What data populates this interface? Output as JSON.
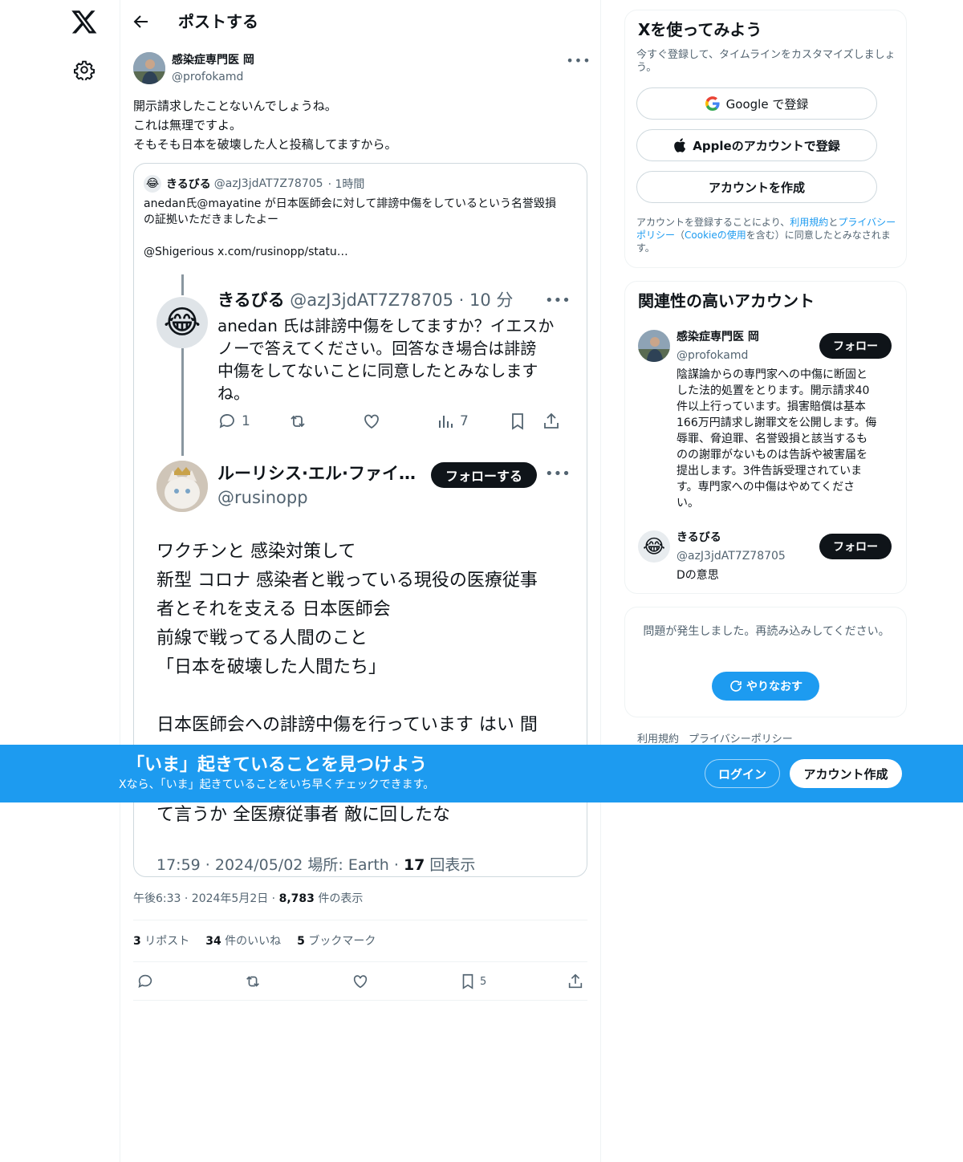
{
  "header": {
    "title": "ポストする"
  },
  "post": {
    "author_name": "感染症専門医 岡",
    "author_handle": "@profokamd",
    "text_lines": [
      "開示請求したことないんでしょうね。",
      "これは無理ですよ。",
      "そもそも日本を破壊した人と投稿してますから。"
    ],
    "quote": {
      "avatar_emoji": "😂",
      "name": "きるびる",
      "handle": "@azJ3jdAT7Z78705",
      "time": "· 1時間",
      "text_lines": [
        "anedan氏@mayatine が日本医師会に対して誹謗中傷をしているという名誉毀損",
        "の証拠いただきましたよー"
      ],
      "link": "@Shigerious  x.com/rusinopp/statu…",
      "screenshot": {
        "reply_name": "きるびる",
        "reply_meta": " @azJ3jdAT7Z78705 · 10 分",
        "reply_lines": [
          "anedan 氏は誹謗中傷をしてますか？イエスか",
          "ノーで答えてください。回答なき場合は誹謗",
          "中傷をしてないことに同意したとみなします",
          "ね。"
        ],
        "reply_reply_count": "1",
        "reply_view_count": "7",
        "orig_name": "ルーリシス·エル·ファイ…",
        "orig_handle": "@rusinopp",
        "follow_label": "フォローする",
        "body_lines": [
          "ワクチンと 感染対策して",
          "新型 コロナ 感染者と戦っている現役の医療従事",
          "者とそれを支える 日本医師会",
          "前線で戦ってる人間のこと",
          "「日本を破壊した人間たち」",
          "",
          "日本医師会への誹謗中傷を行っています はい 間"
        ],
        "tail_line": "て言うか 全医療従事者 敵に回したな",
        "meta_prefix": "17:59 · 2024/05/02 場所: Earth · ",
        "meta_views": "17",
        "meta_suffix": " 回表示"
      }
    },
    "timestamp": "午後6:33 · 2024年5月2日 · ",
    "views": "8,783",
    "views_label": " 件の表示",
    "reposts": "3",
    "reposts_label": " リポスト",
    "likes": "34",
    "likes_label": " 件のいいね",
    "bookmarks": "5",
    "bookmarks_label": " ブックマーク",
    "bookmark_count": "5"
  },
  "signup_card": {
    "title": "Xを使ってみよう",
    "subtitle": "今すぐ登録して、タイムラインをカスタマイズしましょう。",
    "google_label": "Google で登録",
    "apple_label": "Appleのアカウントで登録",
    "create_label": "アカウントを作成",
    "legal_1": "アカウントを登録することにより、",
    "legal_terms": "利用規約",
    "legal_2": "と",
    "legal_privacy": "プライバシーポリシー",
    "legal_3": "（",
    "legal_cookie": "Cookieの使用",
    "legal_4": "を含む）に同意したとみなされます。"
  },
  "related": {
    "title": "関連性の高いアカウント",
    "accounts": [
      {
        "name": "感染症専門医 岡",
        "handle": "@profokamd",
        "follow": "フォロー",
        "bio_lines": [
          "陰謀論からの専門家への中傷に断固と",
          "した法的処置をとります。開示請求40",
          "件以上行っています。損害賠償は基本",
          "166万円請求し謝罪文を公開します。侮",
          "辱罪、脅迫罪、名誉毀損と該当するも",
          "のの謝罪がないものは告訴や被害届を",
          "提出します。3件告訴受理されていま",
          "す。専門家への中傷はやめてくださ",
          "い。"
        ]
      },
      {
        "avatar_emoji": "😂",
        "name": "きるびる",
        "handle": "@azJ3jdAT7Z78705",
        "follow": "フォロー",
        "bio_lines": [
          "Dの意思"
        ]
      }
    ]
  },
  "error_card": {
    "message": "問題が発生しました。再読み込みしてください。",
    "retry": "やりなおす"
  },
  "footer": {
    "terms": "利用規約",
    "privacy": "プライバシーポリシー"
  },
  "banner": {
    "title": "「いま」起きていることを見つけよう",
    "subtitle": "Xなら、「いま」起きていることをいち早くチェックできます。",
    "login": "ログイン",
    "signup": "アカウント作成"
  },
  "colors": {
    "accent": "#1d9bf0",
    "text": "#0f1419",
    "muted": "#536471",
    "border": "#eff3f4"
  }
}
